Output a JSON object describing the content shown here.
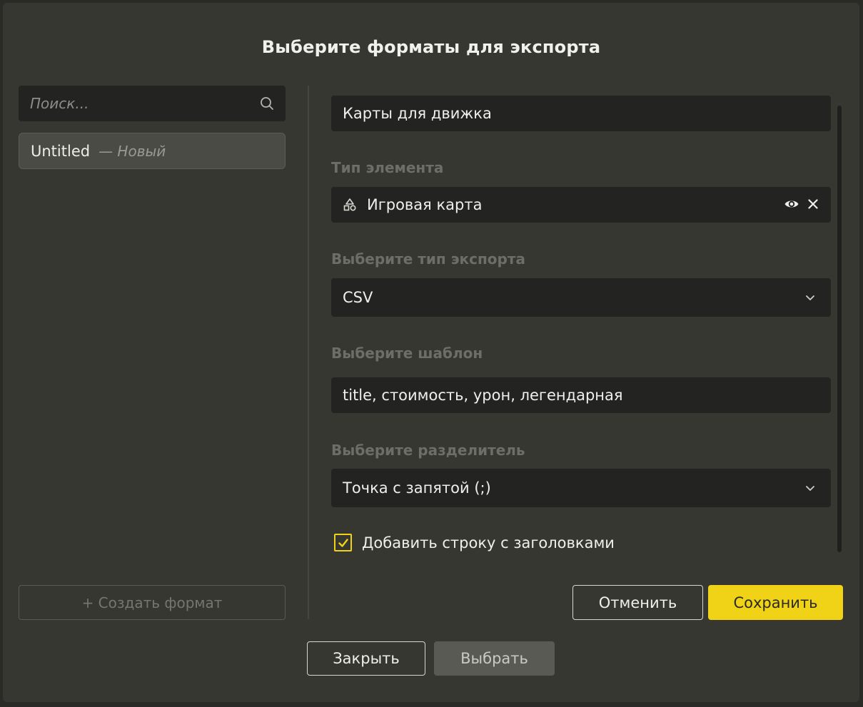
{
  "dialog": {
    "title": "Выберите форматы для экспорта"
  },
  "sidebar": {
    "search_placeholder": "Поиск...",
    "formats": [
      {
        "name": "Untitled",
        "tag": "— Новый"
      }
    ],
    "create_label": "+ Создать формат"
  },
  "form": {
    "name_value": "Карты для движка",
    "element_type_label": "Тип элемента",
    "element_type_value": "Игровая карта",
    "export_type_label": "Выберите тип экспорта",
    "export_type_value": "CSV",
    "template_label": "Выберите шаблон",
    "template_value": "title, стоимость, урон, легендарная",
    "separator_label": "Выберите разделитель",
    "separator_value": "Точка с запятой (;)",
    "header_row_label": "Добавить строку с заголовками",
    "header_row_checked": true,
    "cancel_label": "Отменить",
    "save_label": "Сохранить"
  },
  "footer": {
    "close_label": "Закрыть",
    "select_label": "Выбрать"
  },
  "colors": {
    "accent": "#f0d316",
    "background": "#373732",
    "field": "#232321"
  },
  "icons": {
    "search": "search-icon",
    "element_type": "shapes-icon",
    "view": "eye-icon",
    "clear": "close-icon",
    "dropdown": "chevron-down-icon",
    "check": "checkmark-icon"
  }
}
